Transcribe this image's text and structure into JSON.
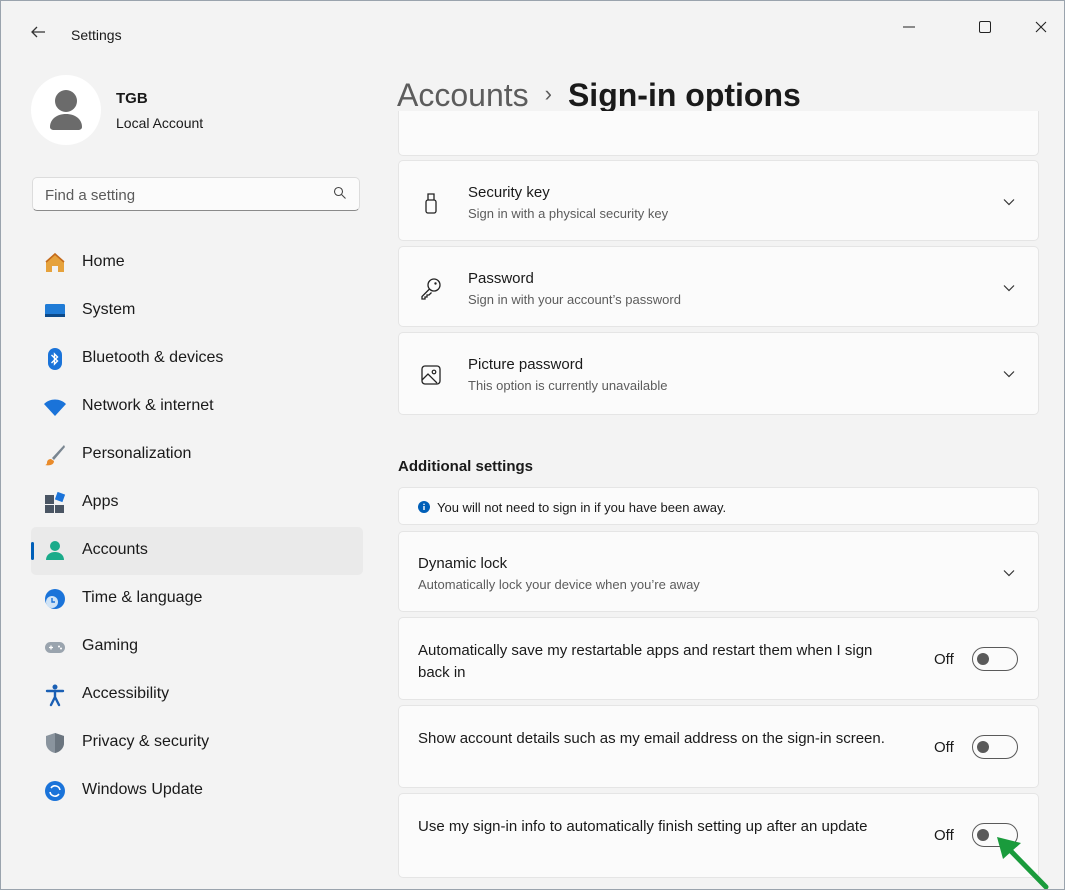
{
  "window": {
    "title": "Settings",
    "controls": [
      "minimize",
      "maximize",
      "close"
    ]
  },
  "user": {
    "name": "TGB",
    "account_type": "Local Account"
  },
  "search": {
    "placeholder": "Find a setting"
  },
  "sidebar": {
    "items": [
      {
        "label": "Home",
        "icon": "home-icon"
      },
      {
        "label": "System",
        "icon": "system-icon"
      },
      {
        "label": "Bluetooth & devices",
        "icon": "bluetooth-icon"
      },
      {
        "label": "Network & internet",
        "icon": "wifi-icon"
      },
      {
        "label": "Personalization",
        "icon": "brush-icon"
      },
      {
        "label": "Apps",
        "icon": "apps-icon"
      },
      {
        "label": "Accounts",
        "icon": "accounts-icon",
        "active": true
      },
      {
        "label": "Time & language",
        "icon": "globe-clock-icon"
      },
      {
        "label": "Gaming",
        "icon": "gamepad-icon"
      },
      {
        "label": "Accessibility",
        "icon": "accessibility-icon"
      },
      {
        "label": "Privacy & security",
        "icon": "shield-icon"
      },
      {
        "label": "Windows Update",
        "icon": "update-icon"
      }
    ]
  },
  "header": {
    "parent": "Accounts",
    "separator": "›",
    "current": "Sign-in options"
  },
  "signin_methods": [
    {
      "title": "Security key",
      "subtitle": "Sign in with a physical security key",
      "icon": "usb-key-icon"
    },
    {
      "title": "Password",
      "subtitle": "Sign in with your account’s password",
      "icon": "key-icon"
    },
    {
      "title": "Picture password",
      "subtitle": "This option is currently unavailable",
      "icon": "picture-icon"
    }
  ],
  "additional": {
    "heading": "Additional settings",
    "info": "You will not need to sign in if you have been away.",
    "dynamic_lock": {
      "title": "Dynamic lock",
      "subtitle": "Automatically lock your device when you’re away"
    },
    "toggles": [
      {
        "label": "Automatically save my restartable apps and restart them when I sign back in",
        "state": "Off"
      },
      {
        "label": "Show account details such as my email address on the sign-in screen.",
        "state": "Off"
      },
      {
        "label": "Use my sign-in info to automatically finish setting up after an update",
        "state": "Off"
      }
    ]
  },
  "colors": {
    "accent": "#005fb8",
    "annotation_arrow": "#1a9b3c"
  }
}
